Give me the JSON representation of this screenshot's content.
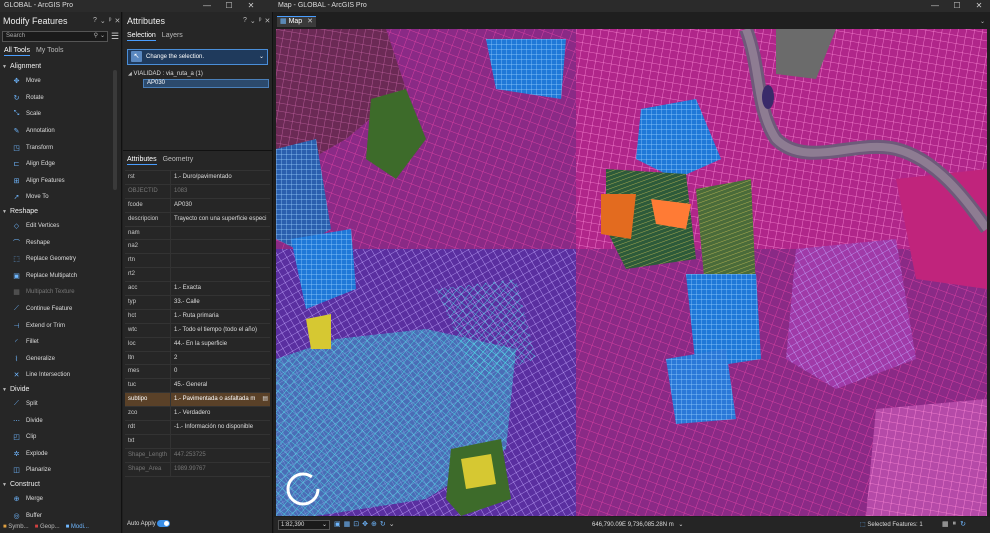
{
  "left_window": {
    "title": "GLOBAL - ArcGIS Pro"
  },
  "right_window": {
    "title": "Map - GLOBAL - ArcGIS Pro"
  },
  "modify_features": {
    "title": "Modify Features",
    "controls": [
      "?",
      "⌄",
      "ᵖ",
      "✕"
    ],
    "search_placeholder": "Search",
    "tabs": [
      "All Tools",
      "My Tools"
    ],
    "groups": [
      {
        "name": "Alignment",
        "tools": [
          {
            "label": "Move",
            "icon": "move-icon",
            "glyph": "✥",
            "enabled": true
          },
          {
            "label": "Rotate",
            "icon": "rotate-icon",
            "glyph": "↻",
            "enabled": true
          },
          {
            "label": "Scale",
            "icon": "scale-icon",
            "glyph": "⤡",
            "enabled": true
          },
          {
            "label": "Annotation",
            "icon": "annotation-icon",
            "glyph": "✎",
            "enabled": true
          },
          {
            "label": "Transform",
            "icon": "transform-icon",
            "glyph": "◳",
            "enabled": true
          },
          {
            "label": "Align Edge",
            "icon": "align-edge-icon",
            "glyph": "⊏",
            "enabled": true
          },
          {
            "label": "Align Features",
            "icon": "align-features-icon",
            "glyph": "⊞",
            "enabled": true
          },
          {
            "label": "Move To",
            "icon": "move-to-icon",
            "glyph": "➚",
            "enabled": true
          }
        ]
      },
      {
        "name": "Reshape",
        "tools": [
          {
            "label": "Edit Vertices",
            "icon": "edit-vertices-icon",
            "glyph": "◇",
            "enabled": true
          },
          {
            "label": "Reshape",
            "icon": "reshape-icon",
            "glyph": "⌒",
            "enabled": true
          },
          {
            "label": "Replace Geometry",
            "icon": "replace-geometry-icon",
            "glyph": "⬚",
            "enabled": true
          },
          {
            "label": "Replace Multipatch",
            "icon": "replace-multipatch-icon",
            "glyph": "▣",
            "enabled": true
          },
          {
            "label": "Multipatch Texture",
            "icon": "multipatch-texture-icon",
            "glyph": "▦",
            "enabled": false
          },
          {
            "label": "Continue Feature",
            "icon": "continue-feature-icon",
            "glyph": "⟋",
            "enabled": true
          },
          {
            "label": "Extend or Trim",
            "icon": "extend-trim-icon",
            "glyph": "⊣",
            "enabled": true
          },
          {
            "label": "Fillet",
            "icon": "fillet-icon",
            "glyph": "◜",
            "enabled": true
          },
          {
            "label": "Generalize",
            "icon": "generalize-icon",
            "glyph": "⌇",
            "enabled": true
          },
          {
            "label": "Line Intersection",
            "icon": "line-intersection-icon",
            "glyph": "✕",
            "enabled": true
          }
        ]
      },
      {
        "name": "Divide",
        "tools": [
          {
            "label": "Split",
            "icon": "split-icon",
            "glyph": "⟋",
            "enabled": true
          },
          {
            "label": "Divide",
            "icon": "divide-icon",
            "glyph": "⋯",
            "enabled": true
          },
          {
            "label": "Clip",
            "icon": "clip-icon",
            "glyph": "◰",
            "enabled": true
          },
          {
            "label": "Explode",
            "icon": "explode-icon",
            "glyph": "✲",
            "enabled": true
          },
          {
            "label": "Planarize",
            "icon": "planarize-icon",
            "glyph": "◫",
            "enabled": true
          }
        ]
      },
      {
        "name": "Construct",
        "tools": [
          {
            "label": "Merge",
            "icon": "merge-icon",
            "glyph": "⊕",
            "enabled": true
          },
          {
            "label": "Buffer",
            "icon": "buffer-icon",
            "glyph": "◎",
            "enabled": true
          }
        ]
      }
    ],
    "bottom_tabs": [
      "Symb...",
      "Geop...",
      "Modi..."
    ]
  },
  "attributes": {
    "title": "Attributes",
    "controls": [
      "?",
      "⌄",
      "ᵖ",
      "✕"
    ],
    "top_tabs": [
      "Selection",
      "Layers"
    ],
    "change_selection": "Change the selection.",
    "tree_layer": "VIALIDAD : via_ruta_a (1)",
    "tree_feature": "AP030",
    "grid_tabs": [
      "Attributes",
      "Geometry"
    ],
    "fields": [
      {
        "k": "rst",
        "v": "1.- Duro/pavimentado",
        "state": ""
      },
      {
        "k": "OBJECTID",
        "v": "1083",
        "state": "ro"
      },
      {
        "k": "fcode",
        "v": "AP030",
        "state": ""
      },
      {
        "k": "descripcion",
        "v": "Trayecto con una superficie especi",
        "state": ""
      },
      {
        "k": "nam",
        "v": "",
        "state": ""
      },
      {
        "k": "na2",
        "v": "",
        "state": ""
      },
      {
        "k": "rtn",
        "v": "",
        "state": ""
      },
      {
        "k": "rt2",
        "v": "",
        "state": ""
      },
      {
        "k": "acc",
        "v": "1.- Exacta",
        "state": ""
      },
      {
        "k": "typ",
        "v": "33.- Calle",
        "state": ""
      },
      {
        "k": "hct",
        "v": "1.- Ruta primaria",
        "state": ""
      },
      {
        "k": "wtc",
        "v": "1.- Todo el tiempo (todo el año)",
        "state": ""
      },
      {
        "k": "loc",
        "v": "44.- En la superficie",
        "state": ""
      },
      {
        "k": "ltn",
        "v": "2",
        "state": ""
      },
      {
        "k": "mes",
        "v": "0",
        "state": ""
      },
      {
        "k": "tuc",
        "v": "45.- General",
        "state": ""
      },
      {
        "k": "subtipo",
        "v": "1.- Pavimentada o asfaltada m",
        "state": "hl"
      },
      {
        "k": "zco",
        "v": "1.- Verdadero",
        "state": ""
      },
      {
        "k": "rdt",
        "v": "-1.- Información no disponible",
        "state": ""
      },
      {
        "k": "txt",
        "v": "",
        "state": ""
      },
      {
        "k": "Shape_Length",
        "v": "447.253725",
        "state": "ro"
      },
      {
        "k": "Shape_Area",
        "v": "1989.99767",
        "state": "ro"
      }
    ],
    "auto_apply": "Auto Apply",
    "auto_apply_on": true
  },
  "map": {
    "tab_label": "Map",
    "scale": "1:82,390",
    "coordinates": "646,790.09E 9,736,085.28N m",
    "selected_features": "Selected Features: 1"
  }
}
